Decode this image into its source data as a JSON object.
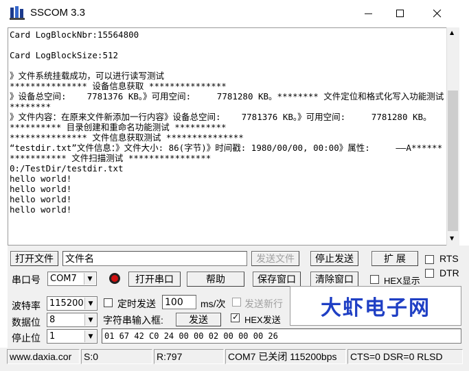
{
  "window": {
    "title": "SSCOM 3.3",
    "minimize_icon": "minimize-icon",
    "maximize_icon": "maximize-icon",
    "close_icon": "close-icon"
  },
  "output": {
    "text": "Card LogBlockNbr:15564800\n\nCard LogBlockSize:512\n\n》文件系统挂载成功，可以进行读写测试\n*************** 设备信息获取 ***************\n》设备总空间:    7781376 KB。》可用空间:     7781280 KB。******** 文件定位和格式化写入功能测试 ********\n》文件内容：在原来文件新添加一行内容》设备总空间:    7781376 KB。》可用空间:     7781280 KB。\n********** 目录创建和重命名功能测试 **********\n*************** 文件信息获取测试 ***************\n“testdir.txt”文件信息：》文件大小: 86(字节)》时间戳: 1980/00/00, 00:00》属性:     ——A***************** 文件扫描测试 ****************\n0:/TestDir/testdir.txt\nhello world!\nhello world!\nhello world!\nhello world!\n"
  },
  "controls": {
    "open_file_label": "打开文件",
    "filename_value": "文件名",
    "send_file_label": "发送文件",
    "stop_send_label": "停止发送",
    "expand_label": "扩 展",
    "rts_label": "RTS",
    "dtr_label": "DTR",
    "port_label": "串口号",
    "port_value": "COM7",
    "open_port_label": "打开串口",
    "help_label": "帮助",
    "save_window_label": "保存窗口",
    "clear_window_label": "清除窗口",
    "hex_display_label": "HEX显示",
    "baud_label": "波特率",
    "baud_value": "115200",
    "timed_send_label": "定时发送",
    "interval_value": "100",
    "interval_unit": "ms/次",
    "send_newline_label": "发送新行",
    "data_bits_label": "数据位",
    "data_bits_value": "8",
    "string_input_label": "字符串输入框:",
    "send_label": "发送",
    "hex_send_label": "HEX发送",
    "stop_bits_label": "停止位",
    "stop_bits_value": "1",
    "send_input_value": "01 67 42 C0 24 00 00 02 00 00 00 26",
    "brand_text": "大虾电子网"
  },
  "status": {
    "url": "www.daxia.cor",
    "sent": "S:0",
    "received": "R:797",
    "port_status": "COM7 已关闭  115200bps",
    "signals": "CTS=0 DSR=0 RLSD"
  },
  "colors": {
    "brand": "#1f3fc4",
    "record_icon": "#d01010"
  }
}
